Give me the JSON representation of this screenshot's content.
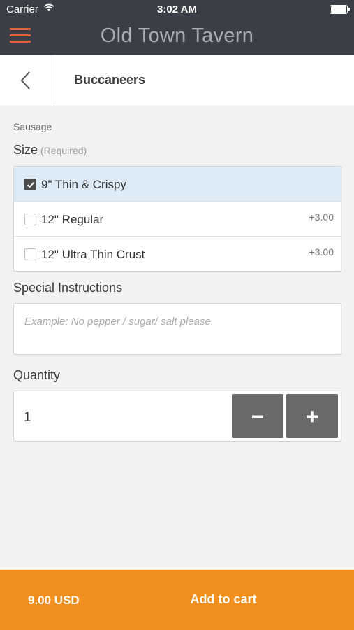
{
  "status_bar": {
    "carrier": "Carrier",
    "time": "3:02 AM"
  },
  "header": {
    "app_title": "Old Town Tavern",
    "menu_icon": "hamburger-menu-icon",
    "menu_color": "#e1603a",
    "background": "#3a3e45"
  },
  "subheader": {
    "back_icon": "chevron-left-icon",
    "title": "Buccaneers"
  },
  "topping_label": "Sausage",
  "size": {
    "title": "Size",
    "required_label": "(Required)",
    "options": [
      {
        "label": "9\" Thin & Crispy",
        "price": "",
        "selected": true
      },
      {
        "label": "12\" Regular",
        "price": "+3.00",
        "selected": false
      },
      {
        "label": "12\" Ultra Thin Crust",
        "price": "+3.00",
        "selected": false
      }
    ]
  },
  "instructions": {
    "title": "Special Instructions",
    "placeholder": "Example: No pepper / sugar/ salt please.",
    "value": ""
  },
  "quantity": {
    "title": "Quantity",
    "value": "1",
    "minus_icon": "minus-icon",
    "plus_icon": "plus-icon"
  },
  "footer": {
    "total": "9.00 USD",
    "add_label": "Add to cart",
    "color": "#ef8f1f"
  }
}
